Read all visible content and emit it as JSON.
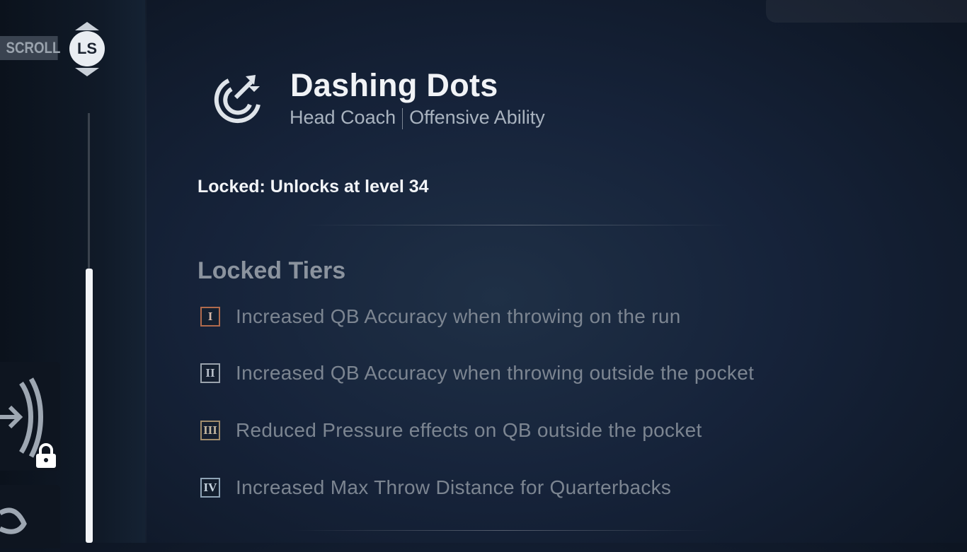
{
  "scroll": {
    "label": "SCROLL",
    "button": "LS"
  },
  "ability": {
    "icon": "target-arrow-icon",
    "title": "Dashing Dots",
    "role": "Head Coach",
    "type": "Offensive Ability",
    "locked_message": "Locked: Unlocks at level 34"
  },
  "tiers": {
    "heading": "Locked Tiers",
    "items": [
      {
        "numeral": "I",
        "text": "Increased QB Accuracy when throwing on the run"
      },
      {
        "numeral": "II",
        "text": "Increased QB Accuracy when throwing outside the pocket"
      },
      {
        "numeral": "III",
        "text": "Reduced Pressure effects on QB outside the pocket"
      },
      {
        "numeral": "IV",
        "text": "Increased Max Throw Distance for Quarterbacks"
      }
    ]
  },
  "sidebar": {
    "tile_icon": "lock-icon",
    "status": "locked"
  }
}
